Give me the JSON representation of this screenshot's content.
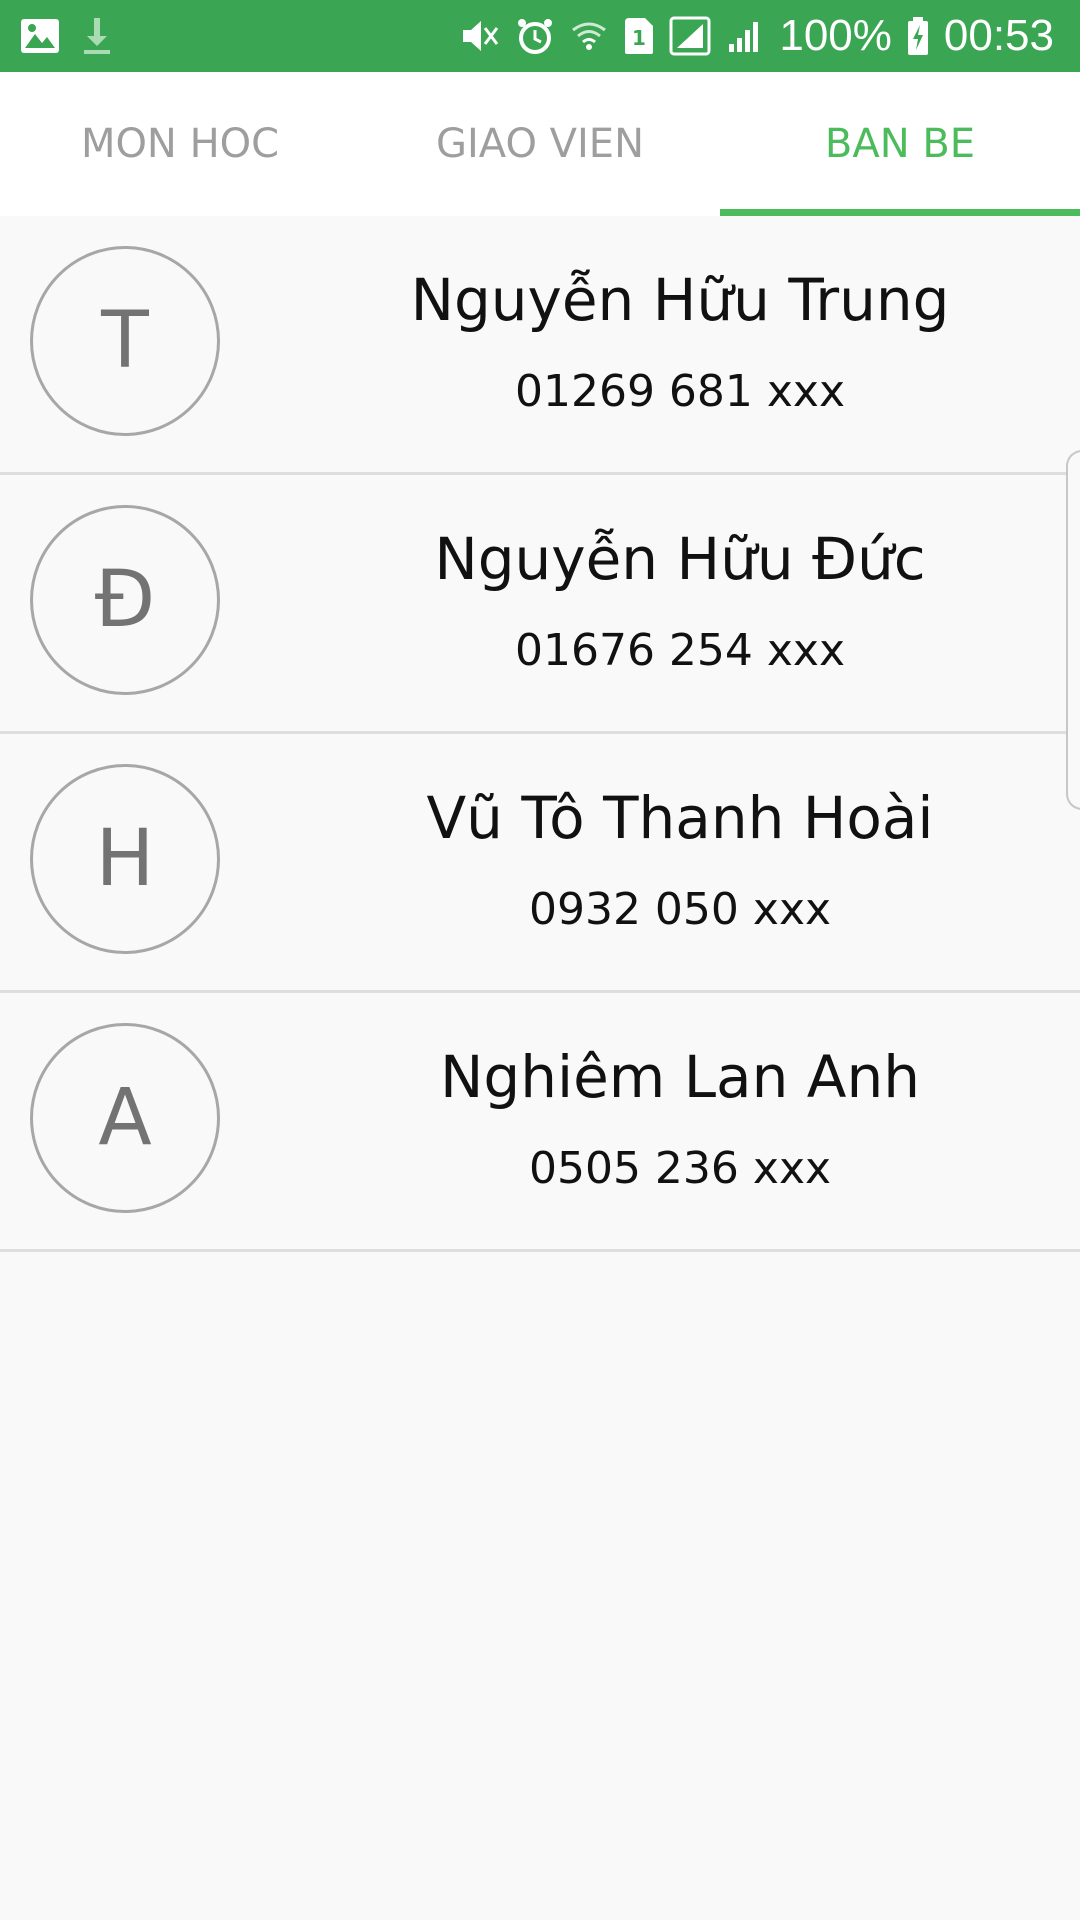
{
  "status_bar": {
    "battery": "100%",
    "time": "00:53",
    "left_icons": [
      "gallery-icon",
      "download-icon"
    ],
    "right_icons": [
      "vibrate-mute-icon",
      "alarm-icon",
      "wifi-icon",
      "sim1-icon",
      "signal-icon",
      "signal-icon",
      "battery-charging-icon"
    ],
    "bg_color": "#3aa552"
  },
  "tabs": [
    {
      "label": "MON HOC",
      "active": false
    },
    {
      "label": "GIAO VIEN",
      "active": false
    },
    {
      "label": "BAN BE",
      "active": true
    }
  ],
  "accent_color": "#4cbb5c",
  "friends": [
    {
      "initial": "T",
      "name": "Nguyễn Hữu Trung",
      "phone": "01269 681 xxx"
    },
    {
      "initial": "Đ",
      "name": "Nguyễn Hữu Đức",
      "phone": "01676 254 xxx"
    },
    {
      "initial": "H",
      "name": "Vũ Tô Thanh Hoài",
      "phone": "0932 050 xxx"
    },
    {
      "initial": "A",
      "name": "Nghiêm Lan Anh",
      "phone": "0505 236 xxx"
    }
  ]
}
